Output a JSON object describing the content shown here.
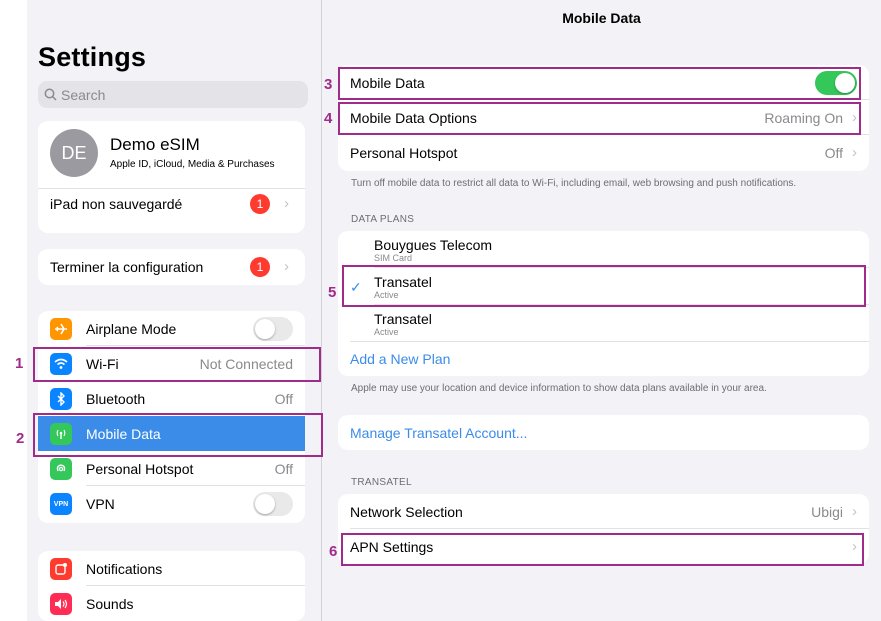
{
  "colors": {
    "accent": "#3b8ce8",
    "toggle_on": "#34c759",
    "badge": "#ff3b30",
    "annotation": "#a12b8a"
  },
  "sidebar": {
    "title": "Settings",
    "search_placeholder": "Search",
    "profile": {
      "initials": "DE",
      "name": "Demo eSIM",
      "subtitle": "Apple ID, iCloud, Media & Purchases"
    },
    "backup": {
      "label": "iPad non sauvegardé",
      "badge": "1"
    },
    "setup": {
      "label": "Terminer la configuration",
      "badge": "1"
    },
    "network_items": [
      {
        "label": "Airplane Mode",
        "value": "",
        "icon": "airplane-icon",
        "color": "#ff9500"
      },
      {
        "label": "Wi-Fi",
        "value": "Not Connected",
        "icon": "wifi-icon",
        "color": "#0a84ff"
      },
      {
        "label": "Bluetooth",
        "value": "Off",
        "icon": "bluetooth-icon",
        "color": "#0a84ff"
      },
      {
        "label": "Mobile Data",
        "value": "",
        "icon": "antenna-icon",
        "color": "#34c759"
      },
      {
        "label": "Personal Hotspot",
        "value": "Off",
        "icon": "hotspot-icon",
        "color": "#34c759"
      },
      {
        "label": "VPN",
        "value": "",
        "icon": "vpn-icon",
        "color": "#0a84ff",
        "icon_text": "VPN"
      }
    ],
    "notification_items": [
      {
        "label": "Notifications",
        "icon": "notifications-icon",
        "color": "#ff3b30"
      },
      {
        "label": "Sounds",
        "icon": "sounds-icon",
        "color": "#ff2d55"
      }
    ]
  },
  "detail": {
    "title": "Mobile Data",
    "mobile_data": {
      "label": "Mobile Data"
    },
    "options": {
      "label": "Mobile Data Options",
      "value": "Roaming On"
    },
    "hotspot": {
      "label": "Personal Hotspot",
      "value": "Off"
    },
    "note1": "Turn off mobile data to restrict all data to Wi-Fi, including email, web browsing and push notifications.",
    "plans_header": "DATA PLANS",
    "plans": [
      {
        "name": "Bouygues Telecom",
        "sub": "SIM Card",
        "checked": false
      },
      {
        "name": "Transatel",
        "sub": "Active",
        "checked": true
      },
      {
        "name": "Transatel",
        "sub": "Active",
        "checked": false
      }
    ],
    "add_plan": "Add a New Plan",
    "note2": "Apple may use your location and device information to show data plans available in your area.",
    "manage": "Manage Transatel Account...",
    "carrier_header": "TRANSATEL",
    "network_selection": {
      "label": "Network Selection",
      "value": "Ubigi"
    },
    "apn": {
      "label": "APN Settings"
    }
  },
  "annotations": [
    "1",
    "2",
    "3",
    "4",
    "5",
    "6"
  ]
}
